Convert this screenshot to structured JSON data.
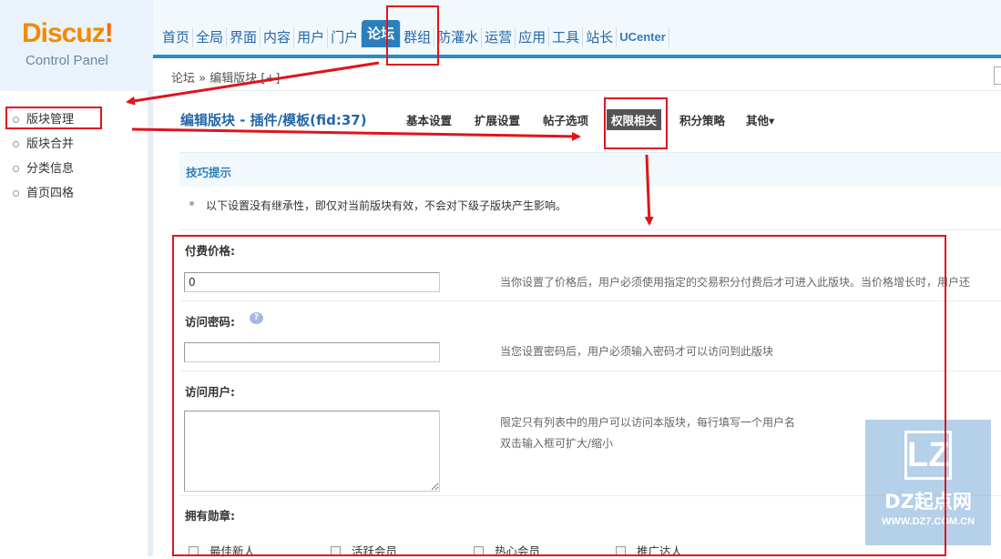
{
  "logo": {
    "brand": "Discuz",
    "bang": "!",
    "subtitle": "Control Panel"
  },
  "topnav": [
    {
      "label": "首页"
    },
    {
      "label": "全局"
    },
    {
      "label": "界面"
    },
    {
      "label": "内容"
    },
    {
      "label": "用户"
    },
    {
      "label": "门户"
    },
    {
      "label": "论坛",
      "active": true
    },
    {
      "label": "群组"
    },
    {
      "label": "防灌水"
    },
    {
      "label": "运营"
    },
    {
      "label": "应用"
    },
    {
      "label": "工具"
    },
    {
      "label": "站长"
    },
    {
      "label": "UCenter"
    }
  ],
  "breadcrumb": "论坛 » 编辑版块  [+]",
  "sidebar": {
    "items": [
      "版块管理",
      "版块合并",
      "分类信息",
      "首页四格"
    ]
  },
  "main": {
    "title": "编辑版块 - 插件/模板(fid:37)",
    "tabs": [
      "基本设置",
      "扩展设置",
      "帖子选项",
      "权限相关",
      "积分策略",
      "其他▾"
    ],
    "active_tab": "权限相关",
    "tips_title": "技巧提示",
    "tip": "以下设置没有继承性，即仅对当前版块有效，不会对下级子版块产生影响。",
    "fields": {
      "price_label": "付费价格:",
      "price_value": "0",
      "price_hint": "当你设置了价格后，用户必须使用指定的交易积分付费后才可进入此版块。当价格增长时，用户还",
      "password_label": "访问密码:",
      "password_hint": "当您设置密码后，用户必须输入密码才可以访问到此版块",
      "users_label": "访问用户:",
      "users_hint_1": "限定只有列表中的用户可以访问本版块，每行填写一个用户名",
      "users_hint_2": "双击输入框可扩大/缩小",
      "medals_label": "拥有勋章:",
      "medals": [
        "最佳新人",
        "活跃会员",
        "热心会员",
        "推广达人"
      ]
    }
  },
  "watermark": {
    "mark": "LZ",
    "name": "DZ起点网",
    "url": "WWW.DZ7.COM.CN"
  },
  "colors": {
    "accent": "#2b7fbf",
    "annotation": "#e0141c",
    "logo": "#f08c00"
  }
}
